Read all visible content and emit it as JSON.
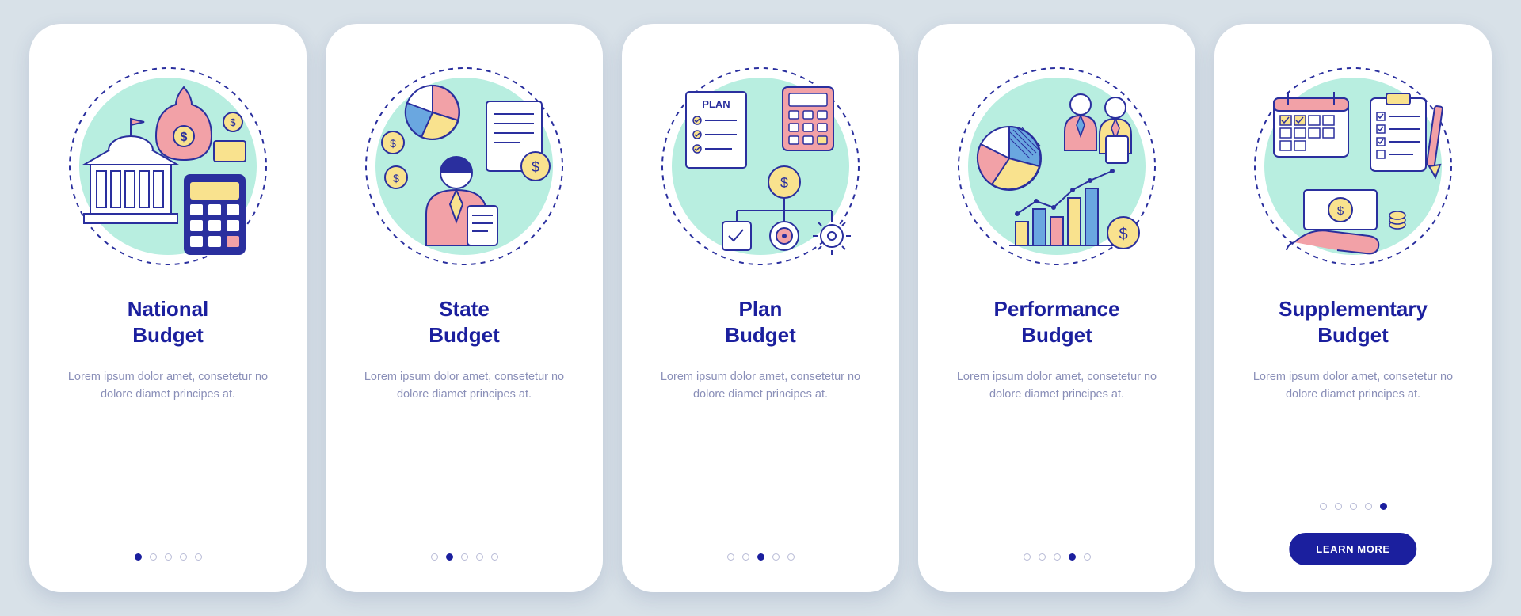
{
  "palette": {
    "primary": "#1b1f9e",
    "accentMint": "#b8eee0",
    "accentPink": "#f2a1a7",
    "accentYellow": "#f9e28e",
    "accentBlue": "#6aa7e0",
    "dashed": "#2a2f9e",
    "textMuted": "#8a8fb8"
  },
  "screens": [
    {
      "id": "national",
      "title": "National\nBudget",
      "desc": "Lorem ipsum dolor amet, consetetur no dolore diamet principes at.",
      "iconSemantics": [
        "government-building-icon",
        "money-bag-icon",
        "calculator-icon",
        "coins-icon"
      ],
      "activeDot": 0,
      "cta": null
    },
    {
      "id": "state",
      "title": "State\nBudget",
      "desc": "Lorem ipsum dolor amet, consetetur no dolore diamet principes at.",
      "iconSemantics": [
        "pie-chart-icon",
        "invoice-icon",
        "coins-icon",
        "clerk-person-icon"
      ],
      "activeDot": 1,
      "cta": null
    },
    {
      "id": "plan",
      "title": "Plan\nBudget",
      "desc": "Lorem ipsum dolor amet, consetetur no dolore diamet principes at.",
      "iconSemantics": [
        "plan-sheet-icon",
        "calculator-icon",
        "flowchart-icon",
        "target-icon",
        "gear-icon",
        "coin-icon"
      ],
      "activeDot": 2,
      "cta": null
    },
    {
      "id": "performance",
      "title": "Performance\nBudget",
      "desc": "Lorem ipsum dolor amet, consetetur no dolore diamet principes at.",
      "iconSemantics": [
        "pie-chart-icon",
        "two-people-icon",
        "bar-chart-icon",
        "trend-line-icon",
        "coin-icon"
      ],
      "activeDot": 3,
      "cta": null
    },
    {
      "id": "supplementary",
      "title": "Supplementary\nBudget",
      "desc": "Lorem ipsum dolor amet, consetetur no dolore diamet principes at.",
      "iconSemantics": [
        "calendar-icon",
        "clipboard-check-icon",
        "pencil-icon",
        "cash-in-hand-icon"
      ],
      "activeDot": 4,
      "cta": "LEARN MORE"
    }
  ],
  "dotsTotal": 5
}
